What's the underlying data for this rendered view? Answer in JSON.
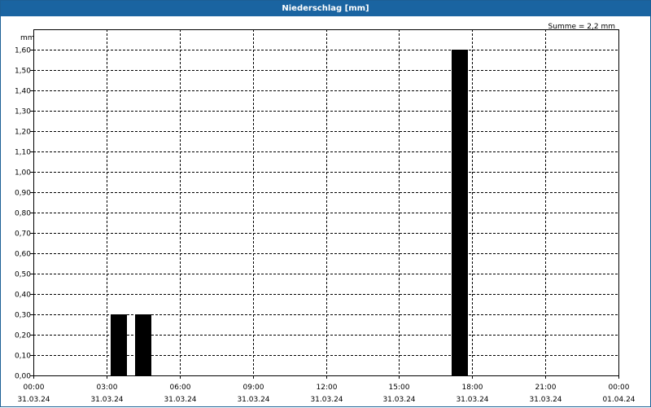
{
  "window": {
    "title": "Niederschlag [mm]"
  },
  "chart_data": {
    "type": "bar",
    "title": "Niederschlag [mm]",
    "annotation": "Summe = 2,2 mm",
    "ylabel": "mm",
    "xlabel": "",
    "ylim": [
      0,
      1.7
    ],
    "y_ticks": [
      "0,00",
      "0,10",
      "0,20",
      "0,30",
      "0,40",
      "0,50",
      "0,60",
      "0,70",
      "0,80",
      "0,90",
      "1,00",
      "1,10",
      "1,20",
      "1,30",
      "1,40",
      "1,50",
      "1,60"
    ],
    "y_tick_values": [
      0,
      0.1,
      0.2,
      0.3,
      0.4,
      0.5,
      0.6,
      0.7,
      0.8,
      0.9,
      1.0,
      1.1,
      1.2,
      1.3,
      1.4,
      1.5,
      1.6
    ],
    "x_range_hours": [
      0,
      24
    ],
    "x_ticks": [
      {
        "hour": 0,
        "time": "00:00",
        "date": "31.03.24"
      },
      {
        "hour": 3,
        "time": "03:00",
        "date": "31.03.24"
      },
      {
        "hour": 6,
        "time": "06:00",
        "date": "31.03.24"
      },
      {
        "hour": 9,
        "time": "09:00",
        "date": "31.03.24"
      },
      {
        "hour": 12,
        "time": "12:00",
        "date": "31.03.24"
      },
      {
        "hour": 15,
        "time": "15:00",
        "date": "31.03.24"
      },
      {
        "hour": 18,
        "time": "18:00",
        "date": "31.03.24"
      },
      {
        "hour": 21,
        "time": "21:00",
        "date": "31.03.24"
      },
      {
        "hour": 24,
        "time": "00:00",
        "date": "01.04.24"
      }
    ],
    "bars": [
      {
        "hour": 3.5,
        "value": 0.3
      },
      {
        "hour": 4.5,
        "value": 0.3
      },
      {
        "hour": 17.5,
        "value": 1.6
      }
    ],
    "grid": true,
    "colors": {
      "bar": "#000000",
      "grid": "#000000",
      "title_bar": "#1a64a1"
    }
  }
}
